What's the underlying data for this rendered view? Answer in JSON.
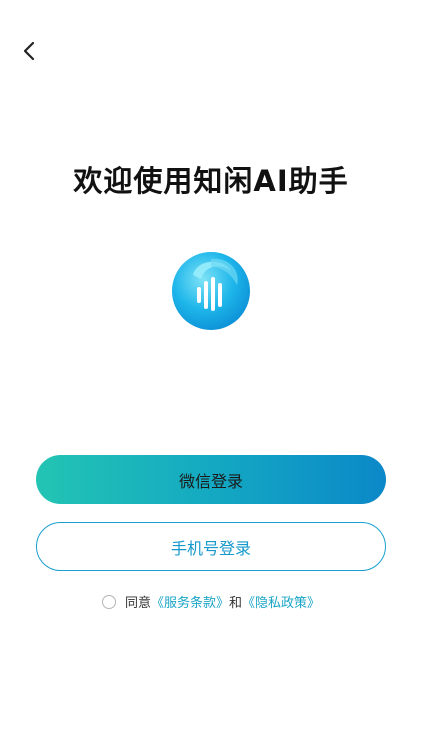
{
  "nav": {
    "back_icon": "chevron-left-icon"
  },
  "welcome": {
    "title": "欢迎使用知闲AI助手"
  },
  "logo": {
    "icon": "sound-wave-icon",
    "accent": "#1ab7ea",
    "secondary": "#5dd8f5"
  },
  "buttons": {
    "wechat_login": "微信登录",
    "phone_login": "手机号登录"
  },
  "agreement": {
    "prefix": "同意",
    "service_terms": "《服务条款》",
    "conjunction": "和",
    "privacy_policy": "《隐私政策》"
  },
  "colors": {
    "gradient_start": "#23c4b3",
    "gradient_end": "#0b88c8",
    "link": "#1aa5c7",
    "outline": "#1a9fd0"
  }
}
